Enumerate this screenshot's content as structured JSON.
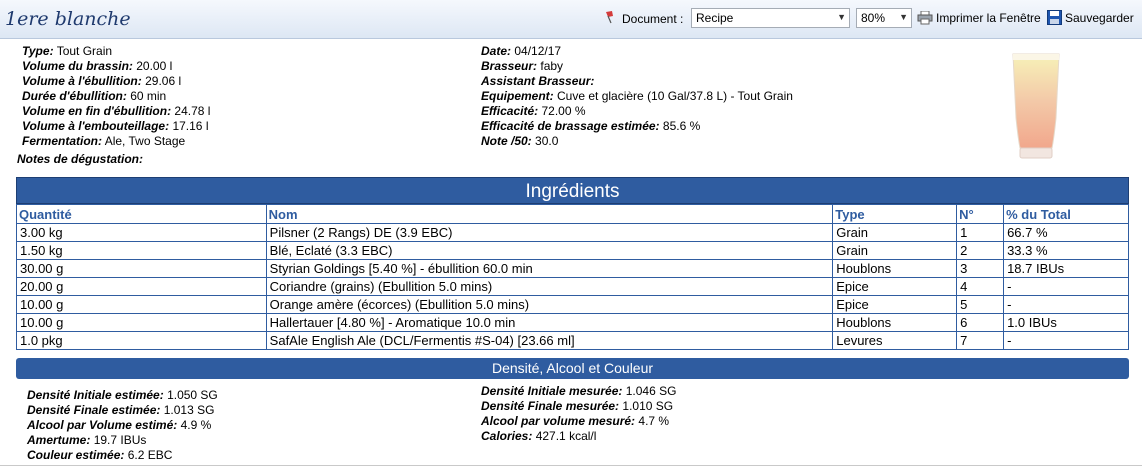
{
  "header": {
    "title": "1ere blanche",
    "document_label": "Document :",
    "document_value": "Recipe",
    "zoom_value": "80%",
    "print_label": "Imprimer la Fenêtre",
    "save_label": "Sauvegarder"
  },
  "left_info": [
    {
      "label": "Type:",
      "value": "Tout Grain"
    },
    {
      "label": "Volume du brassin:",
      "value": "20.00 l"
    },
    {
      "label": "Volume à l'ébullition:",
      "value": "29.06 l"
    },
    {
      "label": "Durée d'ébullition:",
      "value": "60 min"
    },
    {
      "label": "Volume en fin d'ébullition:",
      "value": "24.78 l"
    },
    {
      "label": "Volume à l'embouteillage:",
      "value": "17.16 l"
    },
    {
      "label": "Fermentation:",
      "value": "Ale, Two Stage"
    }
  ],
  "notes_label": "Notes de dégustation:",
  "right_info": [
    {
      "label": "Date:",
      "value": "04/12/17"
    },
    {
      "label": "Brasseur:",
      "value": "faby"
    },
    {
      "label": "Assistant Brasseur:",
      "value": ""
    },
    {
      "label": "Equipement:",
      "value": "Cuve et glacière (10 Gal/37.8 L) - Tout Grain"
    },
    {
      "label": "Efficacité:",
      "value": "72.00 %"
    },
    {
      "label": "Efficacité de brassage estimée:",
      "value": "85.6 %"
    },
    {
      "label": "Note /50:",
      "value": "30.0"
    }
  ],
  "ingredients": {
    "title": "Ingrédients",
    "columns": [
      "Quantité",
      "Nom",
      "Type",
      "N°",
      "% du Total"
    ],
    "rows": [
      [
        "3.00 kg",
        "Pilsner (2 Rangs) DE (3.9 EBC)",
        "Grain",
        "1",
        "66.7 %"
      ],
      [
        "1.50 kg",
        "Blé, Eclaté (3.3 EBC)",
        "Grain",
        "2",
        "33.3 %"
      ],
      [
        "30.00 g",
        "Styrian Goldings [5.40 %] - ébullition 60.0 min",
        "Houblons",
        "3",
        "18.7 IBUs"
      ],
      [
        "20.00 g",
        "Coriandre (grains) (Ebullition 5.0 mins)",
        "Epice",
        "4",
        "-"
      ],
      [
        "10.00 g",
        "Orange amère (écorces) (Ebullition 5.0 mins)",
        "Epice",
        "5",
        "-"
      ],
      [
        "10.00 g",
        "Hallertauer [4.80 %] - Aromatique 10.0 min",
        "Houblons",
        "6",
        "1.0 IBUs"
      ],
      [
        "1.0 pkg",
        "SafAle English Ale (DCL/Fermentis #S-04) [23.66 ml]",
        "Levures",
        "7",
        "-"
      ]
    ]
  },
  "dac": {
    "title": "Densité, Alcool et Couleur",
    "left": [
      {
        "label": "Densité Initiale estimée:",
        "value": "1.050 SG"
      },
      {
        "label": "Densité Finale estimée:",
        "value": "1.013 SG"
      },
      {
        "label": "Alcool par Volume estimé:",
        "value": "4.9 %"
      },
      {
        "label": "Amertume:",
        "value": "19.7 IBUs"
      },
      {
        "label": "Couleur estimée:",
        "value": "6.2 EBC"
      }
    ],
    "right": [
      {
        "label": "Densité Initiale mesurée:",
        "value": "1.046 SG"
      },
      {
        "label": "Densité Finale mesurée:",
        "value": "1.010 SG"
      },
      {
        "label": "Alcool par volume mesuré:",
        "value": "4.7 %"
      },
      {
        "label": "Calories:",
        "value": "427.1 kcal/l"
      }
    ]
  },
  "icons": {
    "pin": "pin-icon",
    "print": "printer-icon",
    "save": "floppy-disk-icon",
    "beer": "beer-glass-icon"
  },
  "colors": {
    "accent": "#2f5ca0",
    "title": "#1f3a6e"
  }
}
